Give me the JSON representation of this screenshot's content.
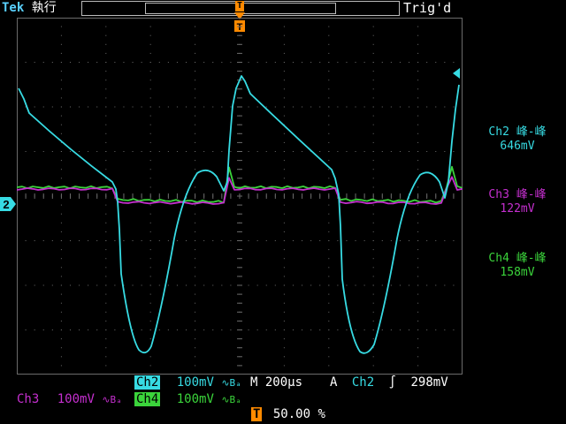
{
  "header": {
    "brand": "Tek",
    "run_state": "執行",
    "trigger_status": "Trig'd",
    "trigger_marker": "T"
  },
  "colors": {
    "ch2": "#37dbe3",
    "ch3": "#c52fcf",
    "ch4": "#3bd43b",
    "trigger": "#ff8a00",
    "grid": "#6b6b6b"
  },
  "measurements": [
    {
      "channel": "Ch2",
      "label": "Ch2 峰-峰",
      "value": "646mV",
      "color": "#37dbe3"
    },
    {
      "channel": "Ch3",
      "label": "Ch3 峰-峰",
      "value": "122mV",
      "color": "#c52fcf"
    },
    {
      "channel": "Ch4",
      "label": "Ch4 峰-峰",
      "value": "158mV",
      "color": "#3bd43b"
    }
  ],
  "channel_marker": "2",
  "bottom": {
    "ch2_name": "Ch2",
    "ch2_scale": "100mV",
    "ch2_bw": "∿Bₐ",
    "time_prefix": "M",
    "timebase": "200µs",
    "trig_source_prefix": "A",
    "trig_source": "Ch2",
    "trig_slope": "∫",
    "trig_level": "298mV",
    "ch3_name": "Ch3",
    "ch3_scale": "100mV",
    "ch4_name": "Ch4",
    "ch4_scale": "100mV",
    "trig_pos_marker": "T",
    "trig_pos": "50.00 %"
  }
}
